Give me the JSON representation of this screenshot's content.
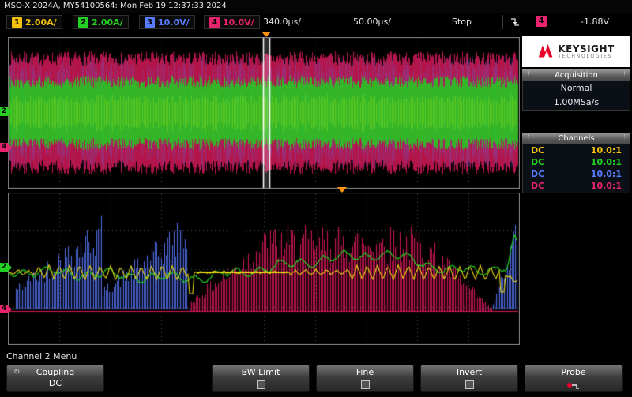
{
  "titlebar": {
    "text": "MSO-X 2024A, MY54100564: Mon Feb 19 12:37:33 2024"
  },
  "status": {
    "channels": [
      {
        "num": "1",
        "scale": "2.00A/",
        "color": "#f4c20d"
      },
      {
        "num": "2",
        "scale": "2.00A/",
        "color": "#23d123"
      },
      {
        "num": "3",
        "scale": "10.0V/",
        "color": "#587bff"
      },
      {
        "num": "4",
        "scale": "10.0V/",
        "color": "#e8246e"
      }
    ],
    "timebase": "340.0µs/",
    "delay": "50.00µs/",
    "run_state": "Stop",
    "trigger": {
      "edge": "falling-edge",
      "source": "4",
      "level": "-1.88V"
    }
  },
  "sidebar": {
    "brand": {
      "name": "KEYSIGHT",
      "tagline": "TECHNOLOGIES"
    },
    "acquisition": {
      "title": "Acquisition",
      "mode": "Normal",
      "sample_rate": "1.00MSa/s"
    },
    "channels": {
      "title": "Channels",
      "rows": [
        {
          "coupling": "DC",
          "probe": "10.0:1",
          "color": "#f4c20d"
        },
        {
          "coupling": "DC",
          "probe": "10.0:1",
          "color": "#23d123"
        },
        {
          "coupling": "DC",
          "probe": "10.0:1",
          "color": "#587bff"
        },
        {
          "coupling": "DC",
          "probe": "10.0:1",
          "color": "#e8246e"
        }
      ]
    }
  },
  "scope": {
    "colors": {
      "ch1": "#e8d60f",
      "ch2": "#1fd01f",
      "ch3": "#5272f0",
      "ch4": "#e01a5e",
      "grid": "#4c4c4c",
      "marker": "#ff9415",
      "brand_red": "#e90029"
    },
    "ground_markers": {
      "top": [
        {
          "label": "2",
          "color": "#23d123"
        },
        {
          "label": "4",
          "color": "#e8246e"
        }
      ],
      "bottom": [
        {
          "label": "2",
          "color": "#23d123"
        },
        {
          "label": "4",
          "color": "#e8246e"
        }
      ]
    }
  },
  "menu": {
    "label": "Channel 2 Menu",
    "softkeys": [
      {
        "label": "Coupling",
        "value": "DC"
      },
      {
        "label": "BW Limit",
        "checked": false
      },
      {
        "label": "Fine",
        "checked": false
      },
      {
        "label": "Invert",
        "checked": false
      },
      {
        "label": "Probe"
      }
    ]
  }
}
